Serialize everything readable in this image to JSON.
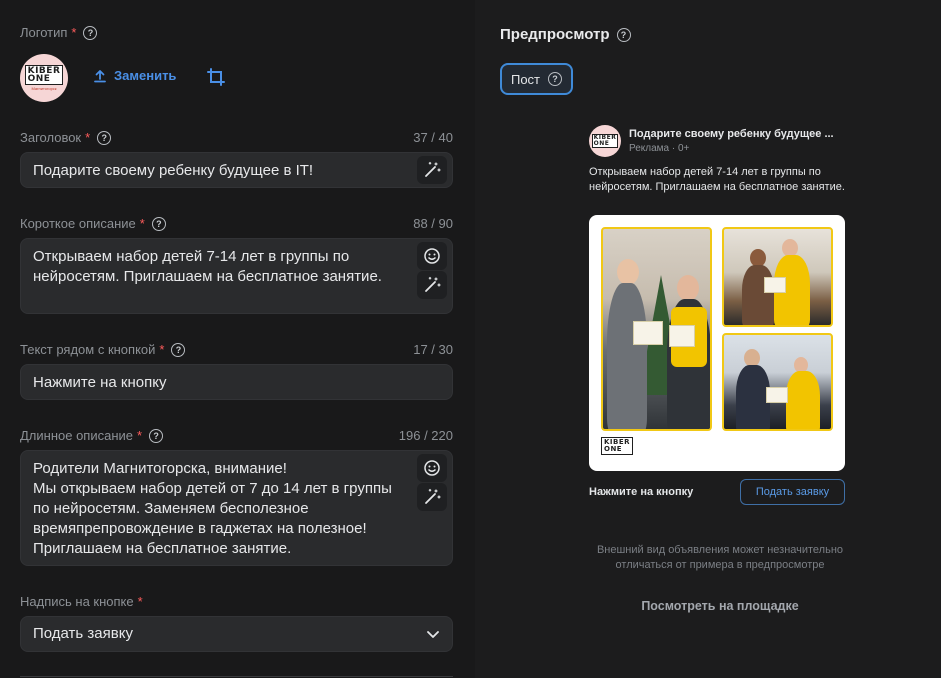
{
  "logo": {
    "label": "Логотип",
    "required_mark": "*",
    "replace_label": "Заменить",
    "brand_top": "KIBER",
    "brand_bottom": "ONE",
    "brand_caption": "Магнитогорск"
  },
  "headline": {
    "label": "Заголовок",
    "required_mark": "*",
    "counter": "37 / 40",
    "value": "Подарите своему ребенку будущее в IT!"
  },
  "short_desc": {
    "label": "Короткое описание",
    "required_mark": "*",
    "counter": "88 / 90",
    "value": "Открываем набор детей 7-14 лет в группы по нейросетям. Приглашаем на бесплатное занятие."
  },
  "button_text": {
    "label": "Текст рядом с кнопкой",
    "required_mark": "*",
    "counter": "17 / 30",
    "value": "Нажмите на кнопку"
  },
  "long_desc": {
    "label": "Длинное описание",
    "required_mark": "*",
    "counter": "196 / 220",
    "line1": "Родители Магнитогорска, внимание!",
    "line2": "Мы открываем набор детей от 7 до 14 лет в группы по нейросетям. Заменяем бесполезное времяпрепровождение в гаджетах на полезное!",
    "line3": "Приглашаем на бесплатное занятие."
  },
  "cta_caption": {
    "label": "Надпись на кнопке",
    "required_mark": "*",
    "selected": "Подать заявку"
  },
  "preview": {
    "title": "Предпросмотр",
    "tab_post": "Пост",
    "ad_title": "Подарите своему ребенку будущее ...",
    "ad_sub": "Реклама · 0+",
    "ad_text": "Открываем набор детей 7-14 лет в группы по нейросетям. Приглашаем на бесплатное занятие.",
    "cta_label": "Нажмите на кнопку",
    "cta_button": "Подать заявку",
    "disclaimer": "Внешний вид объявления может незначительно отличаться от примера в предпросмотре",
    "view_link": "Посмотреть на площадке"
  },
  "colors": {
    "accent": "#4a8fe6",
    "required": "#ff5c5c",
    "field_bg": "#2a2b2d",
    "brand_yellow": "#f1c815"
  },
  "icons": [
    "help-circle-icon",
    "upload-icon",
    "crop-icon",
    "magic-wand-icon",
    "emoji-icon",
    "chevron-down-icon"
  ]
}
